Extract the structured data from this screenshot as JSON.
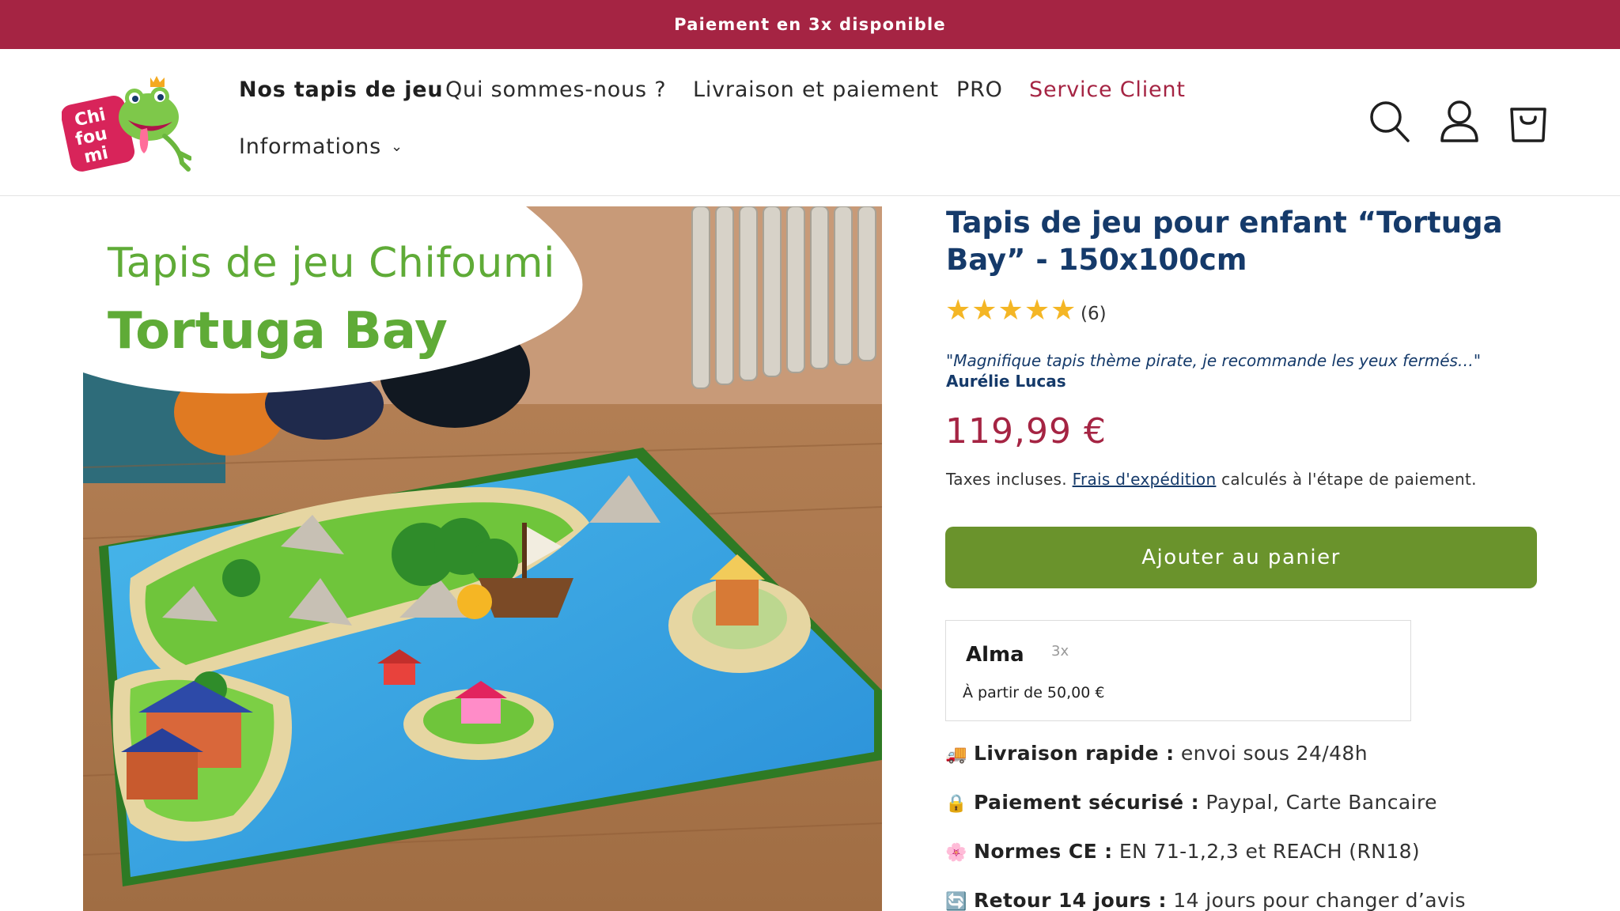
{
  "announcement": "Paiement en 3x disponible",
  "logo": {
    "text_1": "Chi",
    "text_2": "fou",
    "text_3": "mi"
  },
  "nav": {
    "items": [
      {
        "label": "Nos tapis de jeu"
      },
      {
        "label": "Qui sommes-nous ?"
      },
      {
        "label": "Livraison et paiement"
      },
      {
        "label": "PRO"
      },
      {
        "label": "Service Client"
      },
      {
        "label": "Informations"
      }
    ]
  },
  "header_icons": [
    "search-icon",
    "account-icon",
    "cart-icon"
  ],
  "image": {
    "title_line_1": "Tapis de jeu Chifoumi",
    "title_line_2": "Tortuga Bay"
  },
  "product": {
    "title": "Tapis de jeu pour enfant “Tortuga Bay” - 150x100cm",
    "stars": "★★★★★",
    "rating": 5,
    "review_count": "(6)",
    "quote": "\"Magnifique tapis thème pirate, je recommande les yeux fermés…\"",
    "quote_author": "Aurélie Lucas",
    "price": "119,99 €",
    "tax_prefix": "Taxes incluses.",
    "shipping_link": "Frais d'expédition",
    "tax_suffix": "calculés à l'étape de paiement.",
    "add_to_cart": "Ajouter au panier"
  },
  "alma": {
    "logo": "Alma",
    "installments": "3x",
    "from_text": "À partir de 50,00 €"
  },
  "features": [
    {
      "icon": "truck-icon",
      "glyph": "🚚",
      "label": "Livraison rapide :",
      "text": "envoi sous 24/48h"
    },
    {
      "icon": "lock-icon",
      "glyph": "🔒",
      "label": "Paiement sécurisé :",
      "text": "Paypal, Carte Bancaire"
    },
    {
      "icon": "flower-icon",
      "glyph": "🌸",
      "label": "Normes CE :",
      "text": "EN 71-1,2,3 et REACH (RN18)"
    },
    {
      "icon": "return-icon",
      "glyph": "🔄",
      "label": "Retour 14 jours :",
      "text": "14 jours pour changer d’avis"
    }
  ],
  "colors": {
    "brand": "#a52443",
    "title_blue": "#153a6a",
    "cta_green": "#6a932c",
    "star": "#f4b625",
    "image_text_green": "#5fab37"
  }
}
